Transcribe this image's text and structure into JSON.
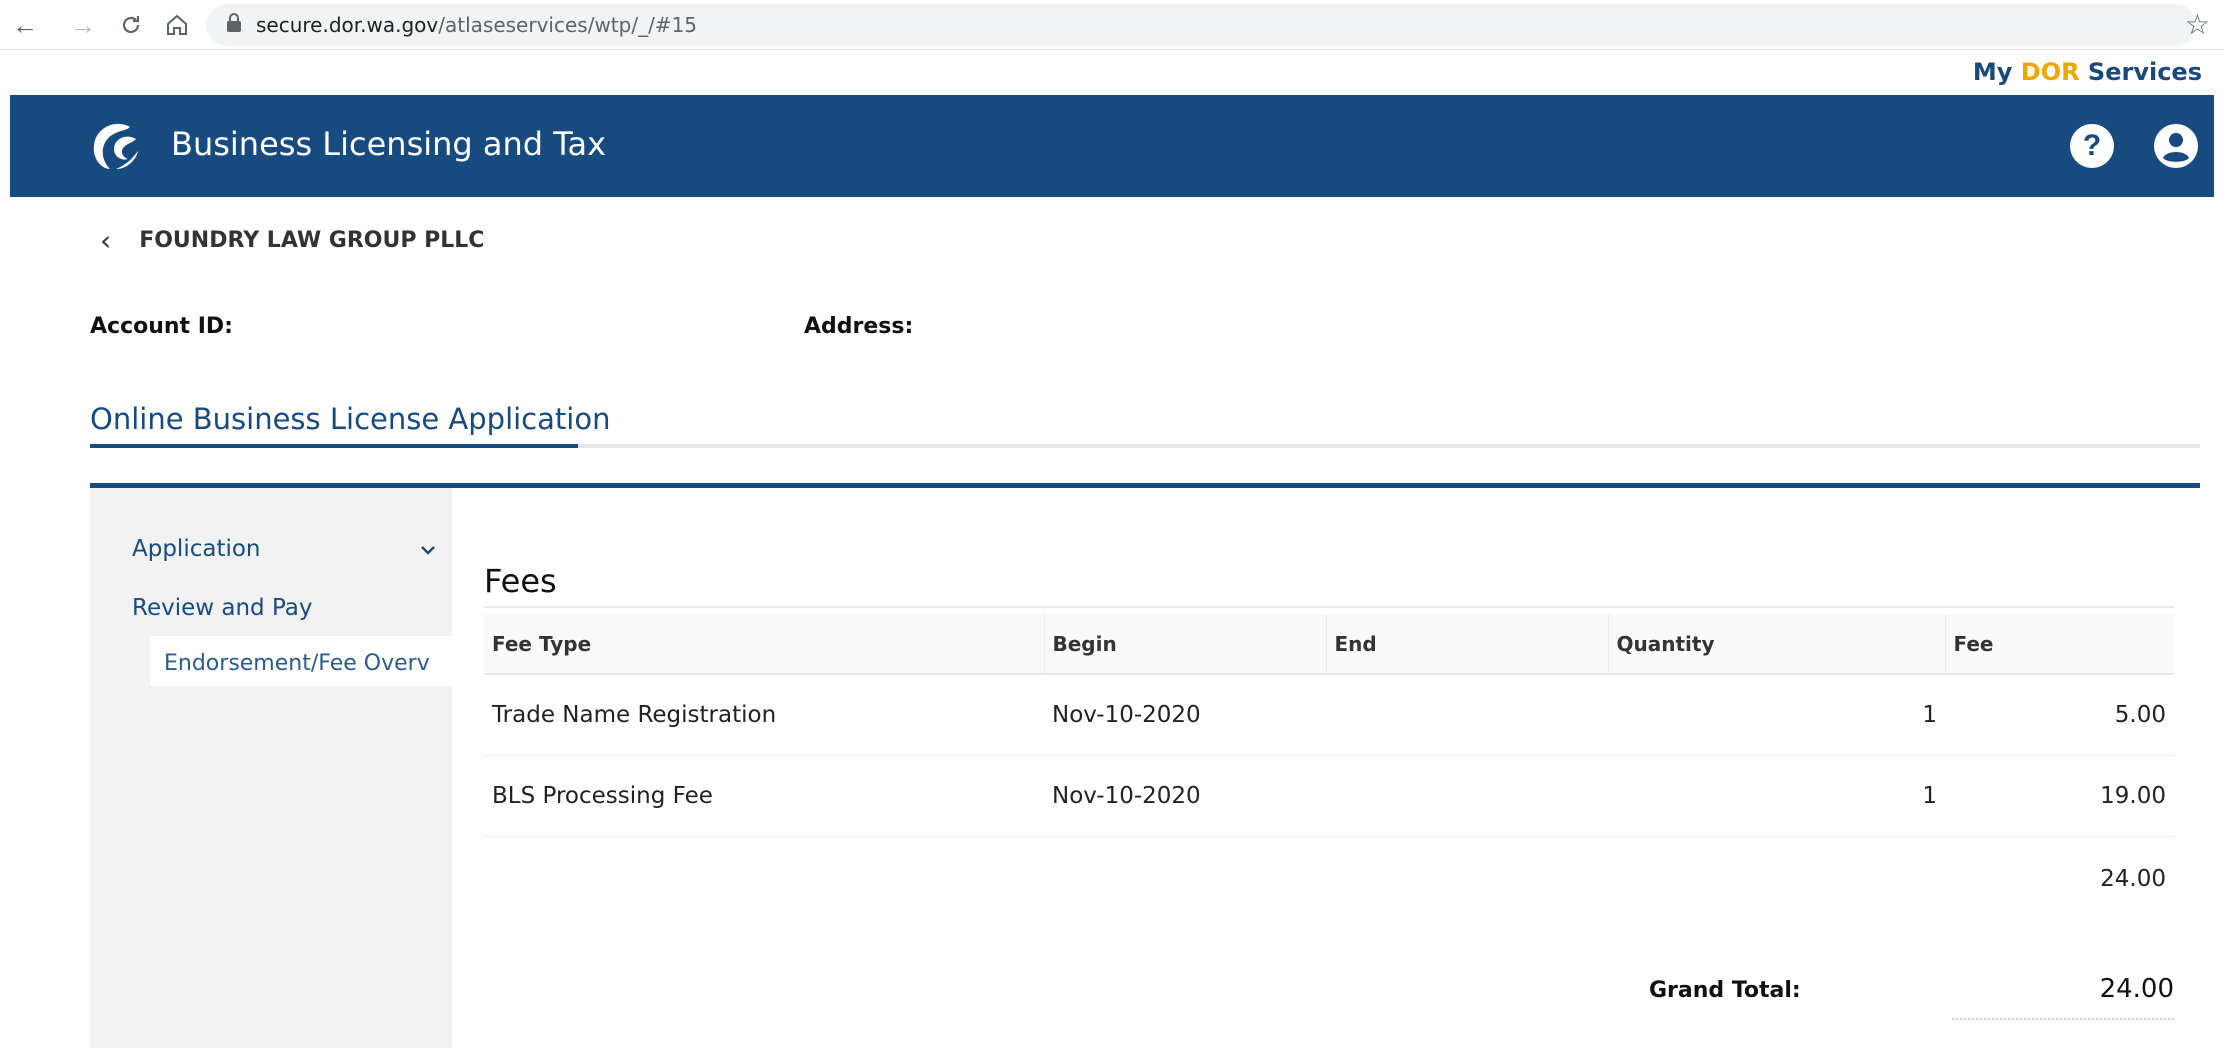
{
  "browser": {
    "url_host": "secure.dor.wa.gov",
    "url_path": "/atlaseservices/wtp/_/#15"
  },
  "top_link": {
    "prefix": "My ",
    "highlight": "DOR",
    "suffix": " Services"
  },
  "header": {
    "title": "Business Licensing and Tax"
  },
  "breadcrumb": {
    "label": "FOUNDRY LAW GROUP PLLC"
  },
  "account": {
    "account_id_label": "Account ID:",
    "address_label": "Address:"
  },
  "page_title": "Online Business License Application",
  "sidebar": {
    "items": [
      {
        "label": "Application"
      },
      {
        "label": "Review and Pay"
      }
    ],
    "sub_item": "Endorsement/Fee Overv"
  },
  "fees": {
    "title": "Fees",
    "columns": [
      "Fee Type",
      "Begin",
      "End",
      "Quantity",
      "Fee"
    ],
    "rows": [
      {
        "fee_type": "Trade Name Registration",
        "begin": "Nov-10-2020",
        "end": "",
        "quantity": "1",
        "fee": "5.00"
      },
      {
        "fee_type": "BLS Processing Fee",
        "begin": "Nov-10-2020",
        "end": "",
        "quantity": "1",
        "fee": "19.00"
      }
    ],
    "subtotal": "24.00",
    "grand_total_label": "Grand Total:",
    "grand_total": "24.00"
  },
  "colors": {
    "brand_blue": "#174a7e",
    "accent_gold": "#f0a800"
  },
  "icons": [
    "back-arrow-icon",
    "forward-arrow-icon",
    "reload-icon",
    "home-icon",
    "lock-icon",
    "star-icon",
    "dor-logo-icon",
    "help-icon",
    "user-icon",
    "chevron-left-icon",
    "chevron-down-icon"
  ]
}
